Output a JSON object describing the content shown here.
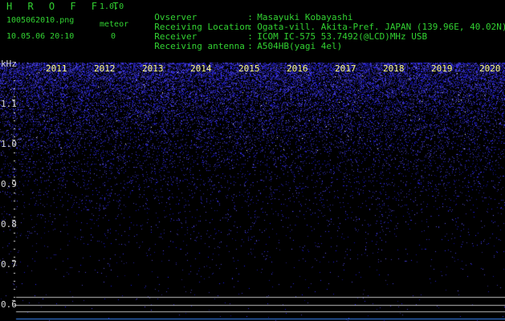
{
  "header": {
    "title": "H R O F F T",
    "version": "1.0.0",
    "filename": "1005062010.png",
    "meteor_label": "meteor",
    "datetime": "10.05.06 20:10",
    "meteor_count": "0"
  },
  "meta": [
    {
      "label": "Ovserver",
      "value": "Masayuki Kobayashi"
    },
    {
      "label": "Receiving Location",
      "value": "Ogata-vill. Akita-Pref. JAPAN (139.96E, 40.02N)"
    },
    {
      "label": "Receiver",
      "value": "ICOM IC-575 53.7492(@LCD)MHz USB"
    },
    {
      "label": "Receiving antenna",
      "value": "A504HB(yagi 4el)"
    }
  ],
  "plot": {
    "unit": "kHz",
    "y_ticks": [
      "1.1",
      "1.0",
      "0.9",
      "0.8",
      "0.7",
      "0.6"
    ],
    "years": [
      "2011",
      "2012",
      "2013",
      "2014",
      "2015",
      "2016",
      "2017",
      "2018",
      "2019",
      "2020"
    ],
    "noise_color": "#2a3cff",
    "meteor_color": "#ffff80",
    "reference_line_color": "#bdbdbd"
  }
}
